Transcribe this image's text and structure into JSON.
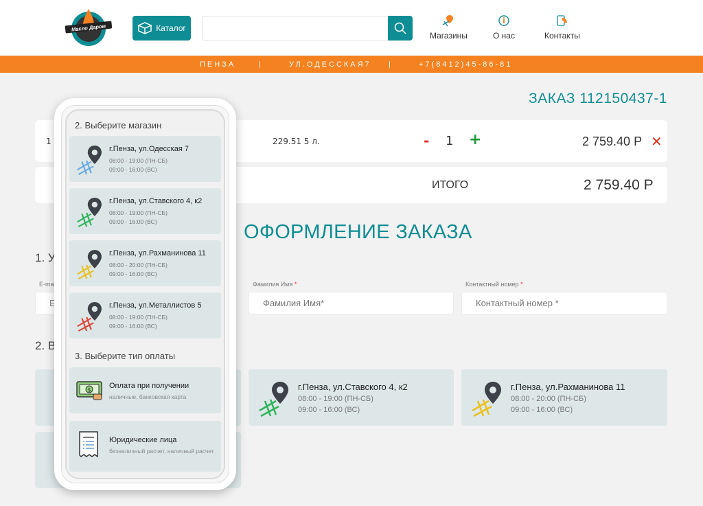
{
  "header": {
    "logo_text": "Масло Даром",
    "catalog_label": "Каталог",
    "search_placeholder": "",
    "nav": [
      {
        "label": "Магазины",
        "icon": "map-pin-icon"
      },
      {
        "label": "О нас",
        "icon": "info-icon"
      },
      {
        "label": "Контакты",
        "icon": "contacts-icon"
      }
    ]
  },
  "infobar": {
    "city": "ПЕНЗА",
    "sep1": "|",
    "street": "УЛ.ОДЕССКАЯ7",
    "sep2": "|",
    "phone": "+7(8412)45-86-81"
  },
  "order": {
    "title": "ЗАКАЗ 112150437-1",
    "item_name": "1",
    "item_volume": "229.51 5 л.",
    "minus": "-",
    "qty": "1",
    "plus": "+",
    "price": "2 759.40 Р",
    "remove": "✕",
    "total_label": "ИТОГО",
    "total_value": "2 759.40 Р"
  },
  "checkout": {
    "title": "ОФОРМЛЕНИЕ ЗАКАЗА",
    "step1_prefix": "1. У",
    "step2_prefix": "2. В",
    "email_label": "E-ma",
    "email_value": "E",
    "name_label": "Фамилия Имя",
    "name_placeholder": "Фамилия Имя*",
    "phone_label": "Контактный номер",
    "phone_placeholder": "Контактный номер *",
    "required_mark": "*"
  },
  "stores": [
    {
      "address": "г.Пенза, ул.Одесская 7",
      "hours_weekday": "08:00 - 19:00 (ПН-СБ)",
      "hours_sunday": "09:00 - 16:00 (ВС)",
      "color": "#6aa8e0"
    },
    {
      "address": "г.Пенза, ул.Ставского 4, к2",
      "hours_weekday": "08:00 - 19:00 (ПН-СБ)",
      "hours_sunday": "09:00 - 16:00 (ВС)",
      "color": "#2fb35a"
    },
    {
      "address": "г.Пенза, ул.Рахманинова 11",
      "hours_weekday": "08:00 - 20:00 (ПН-СБ)",
      "hours_sunday": "09:00 - 16:00 (ВС)",
      "color": "#e8c020"
    },
    {
      "address": "г.Пенза, ул.Металлистов 5",
      "hours_weekday": "08:00 - 19:00 (ПН-СБ)",
      "hours_sunday": "09:00 - 16:00 (ВС)",
      "color": "#e0463a"
    }
  ],
  "mobile": {
    "section_store": "2. Выберите магазин",
    "section_payment": "3. Выберите тип оплаты",
    "payments": [
      {
        "title": "Оплата при получении",
        "subtitle": "наличные, банковская карта",
        "icon": "cash-icon"
      },
      {
        "title": "Юридические лица",
        "subtitle": "безналичный расчет, наличный расчет",
        "icon": "invoice-icon"
      }
    ]
  },
  "colors": {
    "accent": "#0f8d94",
    "orange": "#f58220",
    "card": "#dde7e8"
  }
}
